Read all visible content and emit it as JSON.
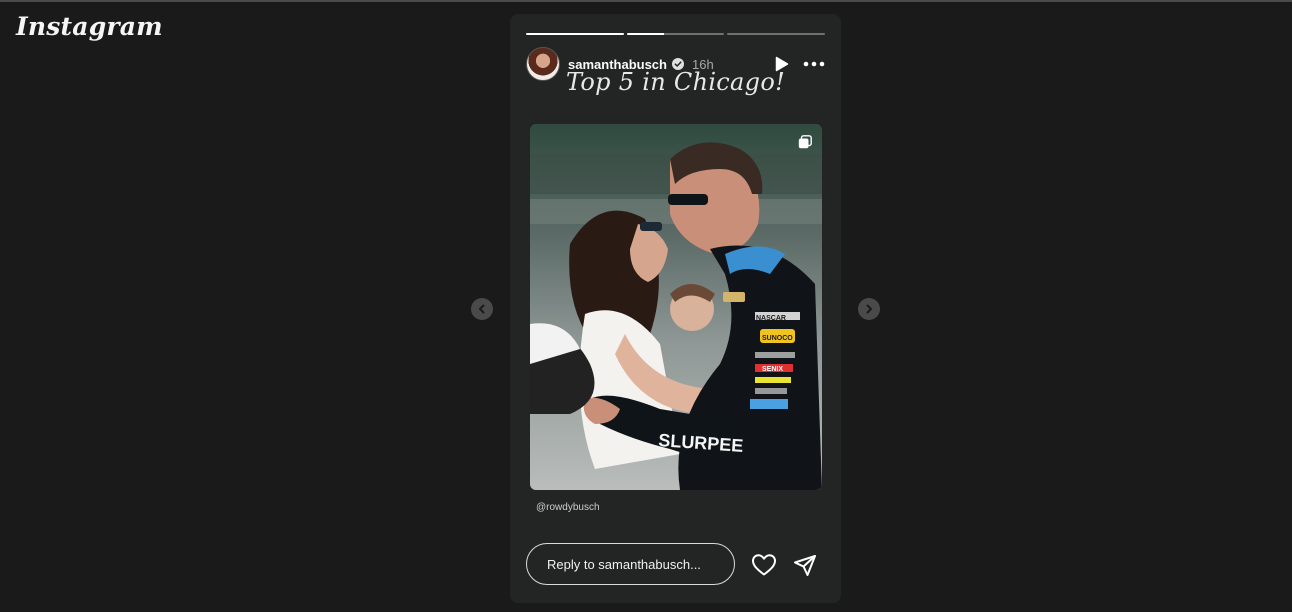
{
  "app": {
    "logo_text": "Instagram"
  },
  "story": {
    "progress_segments": 3,
    "progress_active_index": 1,
    "progress_active_fraction": 0.38,
    "user": {
      "username": "samanthabusch",
      "verified": true,
      "time_ago": "16h"
    },
    "caption_text": "Top 5 in Chicago!",
    "mention_text": "@rowdybusch",
    "photo": {
      "description_icon": "multi-image-icon",
      "suit_labels": [
        "NASCAR",
        "SUNOCO",
        "SENIX",
        "SLURPEE"
      ]
    }
  },
  "reply": {
    "placeholder": "Reply to samanthabusch..."
  },
  "colors": {
    "background": "#1a1a1a",
    "story_bg": "#222524",
    "text": "#fafafa",
    "muted": "#a8a8a8"
  }
}
